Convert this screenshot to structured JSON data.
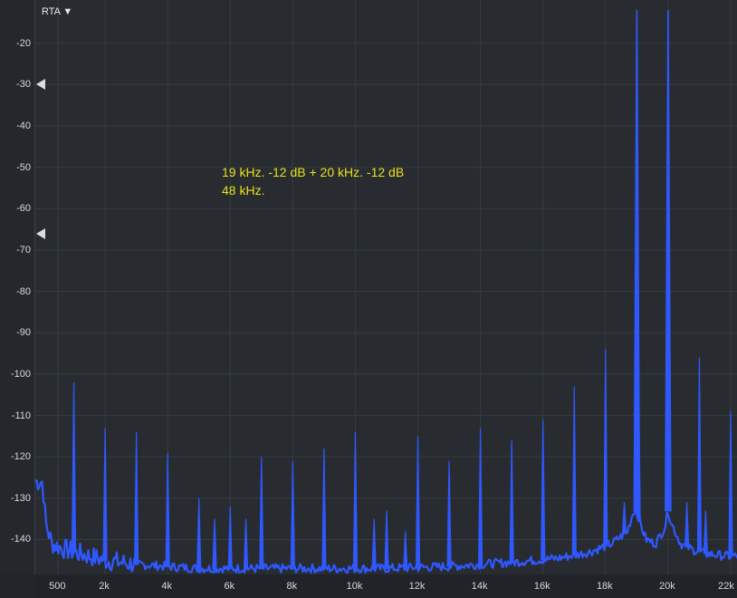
{
  "menu": {
    "rta_label": "RTA ▼"
  },
  "annotation": {
    "line1": "19 kHz. -12 dB + 20 kHz. -12 dB",
    "line2": "48 kHz."
  },
  "colors": {
    "trace": "#2f58ff",
    "background": "#282c31",
    "grid": "#363b41",
    "annotation": "#e8e11a"
  },
  "chart_data": {
    "type": "line",
    "title": "",
    "xlabel": "",
    "ylabel": "",
    "xlim": [
      0,
      22000
    ],
    "ylim": [
      -148,
      -10
    ],
    "grid": true,
    "y_ticks": [
      -20,
      -30,
      -40,
      -50,
      -60,
      -70,
      -80,
      -90,
      -100,
      -110,
      -120,
      -130,
      -140
    ],
    "x_ticks": [
      {
        "value": 500,
        "label": "500"
      },
      {
        "value": 2000,
        "label": "2k"
      },
      {
        "value": 4000,
        "label": "4k"
      },
      {
        "value": 6000,
        "label": "6k"
      },
      {
        "value": 8000,
        "label": "8k"
      },
      {
        "value": 10000,
        "label": "10k"
      },
      {
        "value": 12000,
        "label": "12k"
      },
      {
        "value": 14000,
        "label": "14k"
      },
      {
        "value": 16000,
        "label": "16k"
      },
      {
        "value": 18000,
        "label": "18k"
      },
      {
        "value": 20000,
        "label": "20k"
      },
      {
        "value": 22000,
        "label": "22k"
      }
    ],
    "level_markers": [
      -30,
      -66
    ],
    "noise_floor": [
      {
        "x": 0,
        "y": -126
      },
      {
        "x": 100,
        "y": -136
      },
      {
        "x": 300,
        "y": -141
      },
      {
        "x": 600,
        "y": -142
      },
      {
        "x": 1000,
        "y": -143
      },
      {
        "x": 2000,
        "y": -145
      },
      {
        "x": 3000,
        "y": -146
      },
      {
        "x": 5000,
        "y": -147
      },
      {
        "x": 8000,
        "y": -147
      },
      {
        "x": 11000,
        "y": -147
      },
      {
        "x": 13000,
        "y": -146.5
      },
      {
        "x": 15000,
        "y": -145.5
      },
      {
        "x": 16500,
        "y": -144.5
      },
      {
        "x": 17500,
        "y": -143
      },
      {
        "x": 18200,
        "y": -141
      },
      {
        "x": 18700,
        "y": -138
      },
      {
        "x": 18900,
        "y": -133
      },
      {
        "x": 19000,
        "y": -133
      },
      {
        "x": 19100,
        "y": -136
      },
      {
        "x": 19300,
        "y": -140
      },
      {
        "x": 19600,
        "y": -141
      },
      {
        "x": 19900,
        "y": -137
      },
      {
        "x": 20000,
        "y": -133
      },
      {
        "x": 20100,
        "y": -136
      },
      {
        "x": 20400,
        "y": -141
      },
      {
        "x": 20800,
        "y": -142.5
      },
      {
        "x": 21300,
        "y": -143.5
      },
      {
        "x": 21900,
        "y": -144
      },
      {
        "x": 22000,
        "y": -144
      }
    ],
    "peaks": [
      {
        "x": 1000,
        "y": -102
      },
      {
        "x": 2000,
        "y": -113
      },
      {
        "x": 3000,
        "y": -114
      },
      {
        "x": 4000,
        "y": -119
      },
      {
        "x": 5000,
        "y": -130
      },
      {
        "x": 5500,
        "y": -135
      },
      {
        "x": 6000,
        "y": -132
      },
      {
        "x": 6500,
        "y": -135
      },
      {
        "x": 7000,
        "y": -120
      },
      {
        "x": 8000,
        "y": -121
      },
      {
        "x": 9000,
        "y": -118
      },
      {
        "x": 10000,
        "y": -114
      },
      {
        "x": 10600,
        "y": -135
      },
      {
        "x": 11000,
        "y": -133
      },
      {
        "x": 11600,
        "y": -138
      },
      {
        "x": 12000,
        "y": -115
      },
      {
        "x": 13000,
        "y": -121
      },
      {
        "x": 14000,
        "y": -113
      },
      {
        "x": 15000,
        "y": -116
      },
      {
        "x": 16000,
        "y": -111
      },
      {
        "x": 17000,
        "y": -103
      },
      {
        "x": 18000,
        "y": -94
      },
      {
        "x": 18600,
        "y": -131
      },
      {
        "x": 19000,
        "y": -12
      },
      {
        "x": 19050,
        "y": -95
      },
      {
        "x": 20000,
        "y": -12
      },
      {
        "x": 20600,
        "y": -131
      },
      {
        "x": 21000,
        "y": -96
      },
      {
        "x": 21200,
        "y": -133
      },
      {
        "x": 22000,
        "y": -109
      }
    ]
  }
}
